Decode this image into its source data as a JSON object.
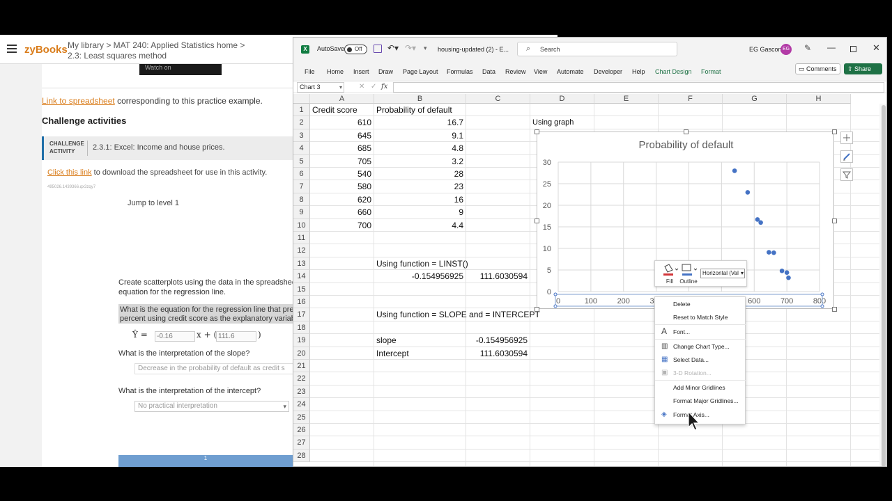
{
  "zybooks": {
    "logo": "zyBooks",
    "breadcrumb_line1": "My library > MAT 240: Applied Statistics home >",
    "breadcrumb_line2": "2.3: Least squares method",
    "video_label": "Watch on",
    "link_text": "Link to spreadsheet",
    "link_rest": " corresponding to this practice example.",
    "challenge_title": "Challenge activities",
    "activity_tag_line1": "CHALLENGE",
    "activity_tag_line2": "ACTIVITY",
    "activity_title": "2.3.1: Excel: Income and house prices.",
    "download_link": "Click this link",
    "download_rest": " to download the spreadsheet for use in this activity.",
    "activity_id": "495026.1439366.qx3zqy7",
    "jump": "Jump to level 1",
    "intro_line1": "Create scatterplots using the data in the spreadsheet",
    "intro_line2": "equation for the regression line.",
    "question_line1": "What is the equation for the regression line that pred",
    "question_line2": "percent using credit score as the explanatory variabl",
    "eq_prefix": "Ŷ =",
    "eq_slope": "-0.16",
    "eq_mid": "x + (",
    "eq_intercept": "111.6",
    "eq_suffix": ")",
    "slope_question": "What is the interpretation of the slope?",
    "slope_answer": "Decrease in the probability of default as credit s",
    "intercept_question": "What is the interpretation of the intercept?",
    "intercept_answer": "No practical interpretation",
    "progress_label": "1"
  },
  "excel": {
    "autosave_label": "AutoSave",
    "autosave_state": "Off",
    "filename": "housing-updated (2)  -  E...",
    "search_placeholder": "Search",
    "user_name": "EG Gascon",
    "user_initials": "EG",
    "tabs": [
      "File",
      "Home",
      "Insert",
      "Draw",
      "Page Layout",
      "Formulas",
      "Data",
      "Review",
      "View",
      "Automate",
      "Developer",
      "Help",
      "Chart Design",
      "Format"
    ],
    "comments_label": "Comments",
    "share_label": "Share",
    "name_box": "Chart 3",
    "fx_label": "fx",
    "columns": [
      "A",
      "B",
      "C",
      "D",
      "E",
      "F",
      "G",
      "H"
    ],
    "rows": [
      "1",
      "2",
      "3",
      "4",
      "5",
      "6",
      "7",
      "8",
      "9",
      "10",
      "11",
      "12",
      "13",
      "14",
      "15",
      "16",
      "17",
      "18",
      "19",
      "20",
      "21",
      "22",
      "23",
      "24",
      "25",
      "26",
      "27",
      "28"
    ],
    "cells": {
      "A1": "Credit score",
      "B1": "Probability of default",
      "A2": "610",
      "B2": "16.7",
      "A3": "645",
      "B3": "9.1",
      "A4": "685",
      "B4": "4.8",
      "A5": "705",
      "B5": "3.2",
      "A6": "540",
      "B6": "28",
      "A7": "580",
      "B7": "23",
      "A8": "620",
      "B8": "16",
      "A9": "660",
      "B9": "9",
      "A10": "700",
      "B10": "4.4",
      "B13": "Using  function = LINST()",
      "B14": "-0.154956925",
      "C14": "111.6030594",
      "B17": "Using function = SLOPE  and = INTERCEPT",
      "B19": "slope",
      "C19": "-0.154956925",
      "B20": "Intercept",
      "C20": "111.6030594",
      "D2": "Using graph"
    }
  },
  "chart_data": {
    "type": "scatter",
    "title": "Probability of default",
    "x": [
      610,
      645,
      685,
      705,
      540,
      580,
      620,
      660,
      700
    ],
    "y": [
      16.7,
      9.1,
      4.8,
      3.2,
      28,
      23,
      16,
      9,
      4.4
    ],
    "xlim": [
      0,
      800
    ],
    "ylim": [
      0,
      30
    ],
    "x_ticks": [
      "0",
      "100",
      "200",
      "300",
      "400",
      "500",
      "600",
      "700",
      "800"
    ],
    "y_ticks": [
      "0",
      "5",
      "10",
      "15",
      "20",
      "25",
      "30"
    ],
    "grid": true,
    "point_color": "#4472c4"
  },
  "minibar": {
    "fill_label": "Fill",
    "outline_label": "Outline",
    "element_select": "Horizontal (Val"
  },
  "context_menu": {
    "items": [
      "Delete",
      "Reset to Match Style",
      "Font...",
      "Change Chart Type...",
      "Select Data...",
      "3-D Rotation...",
      "Add Minor Gridlines",
      "Format Major Gridlines...",
      "Format Axis..."
    ]
  },
  "colors": {
    "excel_green": "#1e7145",
    "zybooks_orange": "#d97c1a",
    "avatar": "#b23aa6"
  }
}
